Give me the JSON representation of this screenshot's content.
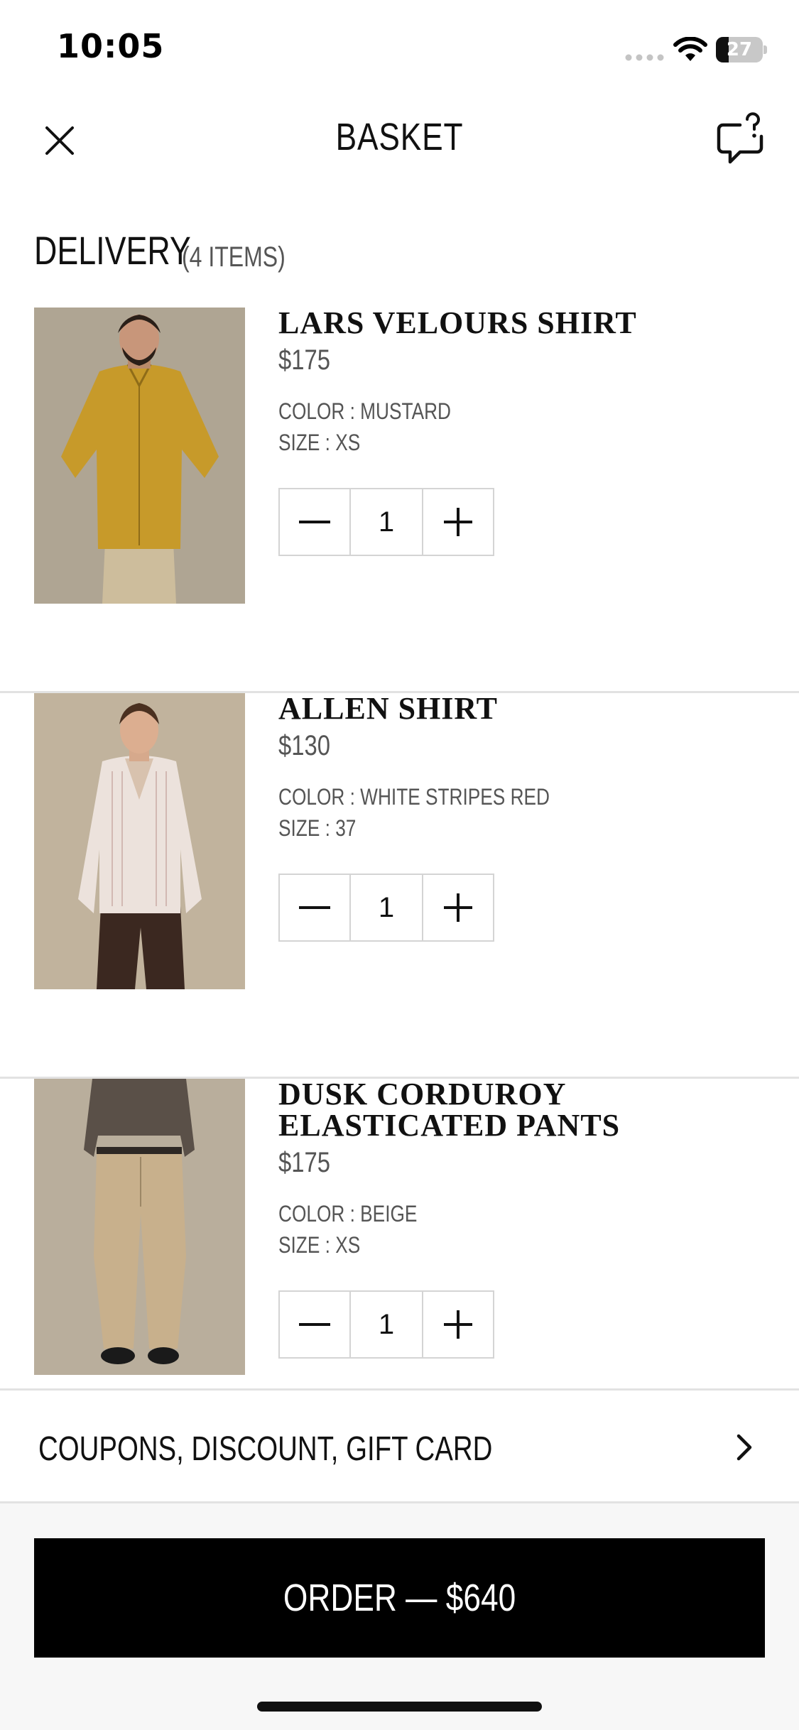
{
  "status_bar": {
    "time": "10:05",
    "battery_percent": "27",
    "battery_level": 0.27
  },
  "header": {
    "title": "BASKET",
    "close_icon": "close-icon",
    "help_icon": "chat-question-icon"
  },
  "section": {
    "title": "DELIVERY",
    "count": "(4 ITEMS)"
  },
  "items": [
    {
      "name": "LARS VELOURS SHIRT",
      "price": "$175",
      "color": "COLOR : MUSTARD",
      "size": "SIZE : XS",
      "quantity": "1",
      "image": {
        "desc_icon": "product-photo-mustard-shirt",
        "shirt_color": "#c79a2a",
        "pants_color": "#cdbd9c",
        "bg_color": "#b3a997"
      }
    },
    {
      "name": "ALLEN SHIRT",
      "price": "$130",
      "color": "COLOR : WHITE STRIPES RED",
      "size": "SIZE : 37",
      "quantity": "1",
      "image": {
        "desc_icon": "product-photo-white-shirt",
        "shirt_color": "#ece2dc",
        "pants_color": "#3b2820",
        "bg_color": "#c1b39d"
      }
    },
    {
      "name": "DUSK CORDUROY\nELASTICATED PANTS",
      "price": "$175",
      "color": "COLOR : BEIGE",
      "size": "SIZE : XS",
      "quantity": "1",
      "image": {
        "desc_icon": "product-photo-beige-pants",
        "shirt_color": "#5a5048",
        "pants_color": "#c8b08c",
        "bg_color": "#b9ae9c"
      }
    }
  ],
  "coupon": {
    "label": "COUPONS, DISCOUNT, GIFT CARD",
    "icon": "chevron-right-icon"
  },
  "order": {
    "label": "ORDER — $640"
  },
  "colors": {
    "accent": "#000000",
    "divider": "#e2e2e2",
    "muted_text": "#555555"
  }
}
